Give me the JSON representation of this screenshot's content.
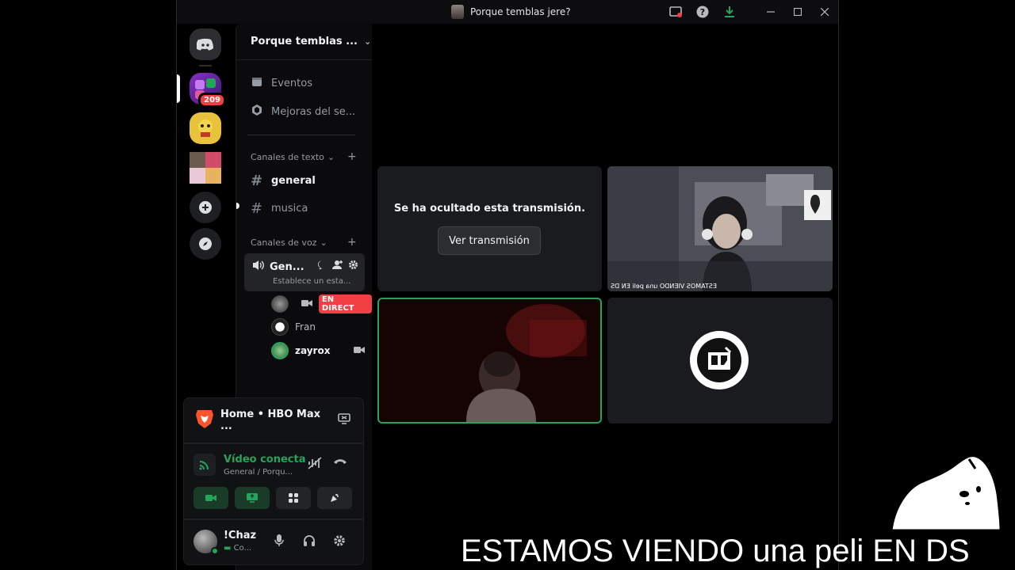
{
  "window": {
    "title": "Porque temblas jere?"
  },
  "titlebar": {
    "icons": [
      "inbox-icon",
      "help-icon",
      "download-icon",
      "minimize-icon",
      "maximize-icon",
      "close-icon"
    ]
  },
  "rail": {
    "badge": "209"
  },
  "sidebar": {
    "guild_name": "Porque temblas ...",
    "events": "Eventos",
    "boosts": "Mejoras del se...",
    "text_category": "Canales de texto",
    "text_channels": [
      "general",
      "musica"
    ],
    "voice_category": "Canales de voz",
    "voice_channel": {
      "name": "Gen...",
      "status": "Establece un esta..."
    },
    "voice_users": [
      {
        "name": "",
        "live": "EN DIRECT"
      },
      {
        "name": "Fran"
      },
      {
        "name": "zayrox"
      }
    ]
  },
  "stream_panel": {
    "title": "Home • HBO Max ..."
  },
  "voice_panel": {
    "status": "Vídeo conecta",
    "location": "General / Porqu..."
  },
  "user_panel": {
    "name": "!Chaz",
    "status": "Co..."
  },
  "stage": {
    "hidden_message": "Se ha ocultado esta transmisión.",
    "watch_button": "Ver transmisión",
    "cam_caption": "ESTAMOS VIENDO una peli EN DS"
  },
  "overlay": {
    "caption": "ESTAMOS VIENDO una peli EN DS"
  },
  "colors": {
    "green": "#23a55a",
    "red": "#f23f43",
    "blurple": "#5865f2"
  }
}
